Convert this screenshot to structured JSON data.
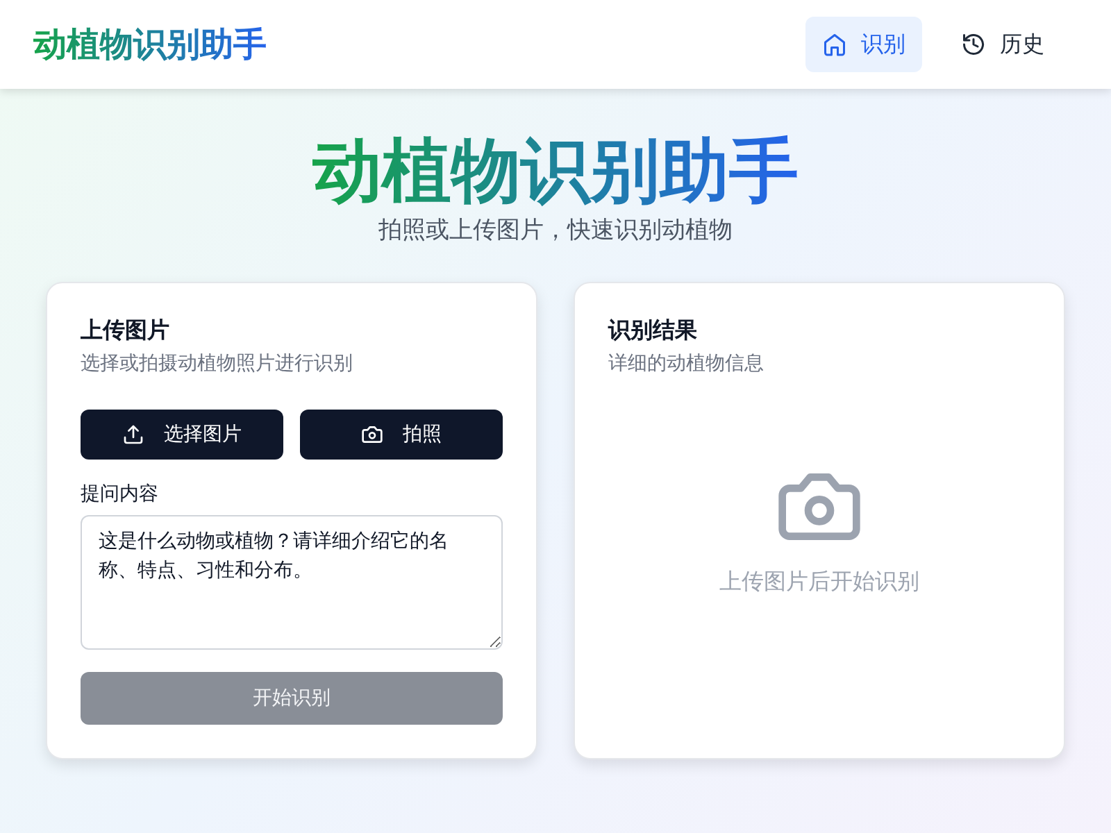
{
  "header": {
    "logo": "动植物识别助手",
    "nav": [
      {
        "label": "识别",
        "selected": true
      },
      {
        "label": "历史",
        "selected": false
      }
    ]
  },
  "hero": {
    "title": "动植物识别助手",
    "subtitle": "拍照或上传图片，快速识别动植物"
  },
  "upload_card": {
    "title": "上传图片",
    "subtitle": "选择或拍摄动植物照片进行识别",
    "buttons": [
      {
        "label": "选择图片"
      },
      {
        "label": "拍照"
      }
    ],
    "prompt": {
      "label": "提问内容",
      "value": "这是什么动物或植物？请详细介绍它的名称、特点、习性和分布。"
    },
    "submit": {
      "label": "开始识别",
      "disabled": true
    }
  },
  "result_card": {
    "title": "识别结果",
    "subtitle": "详细的动植物信息",
    "empty_text": "上传图片后开始识别"
  }
}
